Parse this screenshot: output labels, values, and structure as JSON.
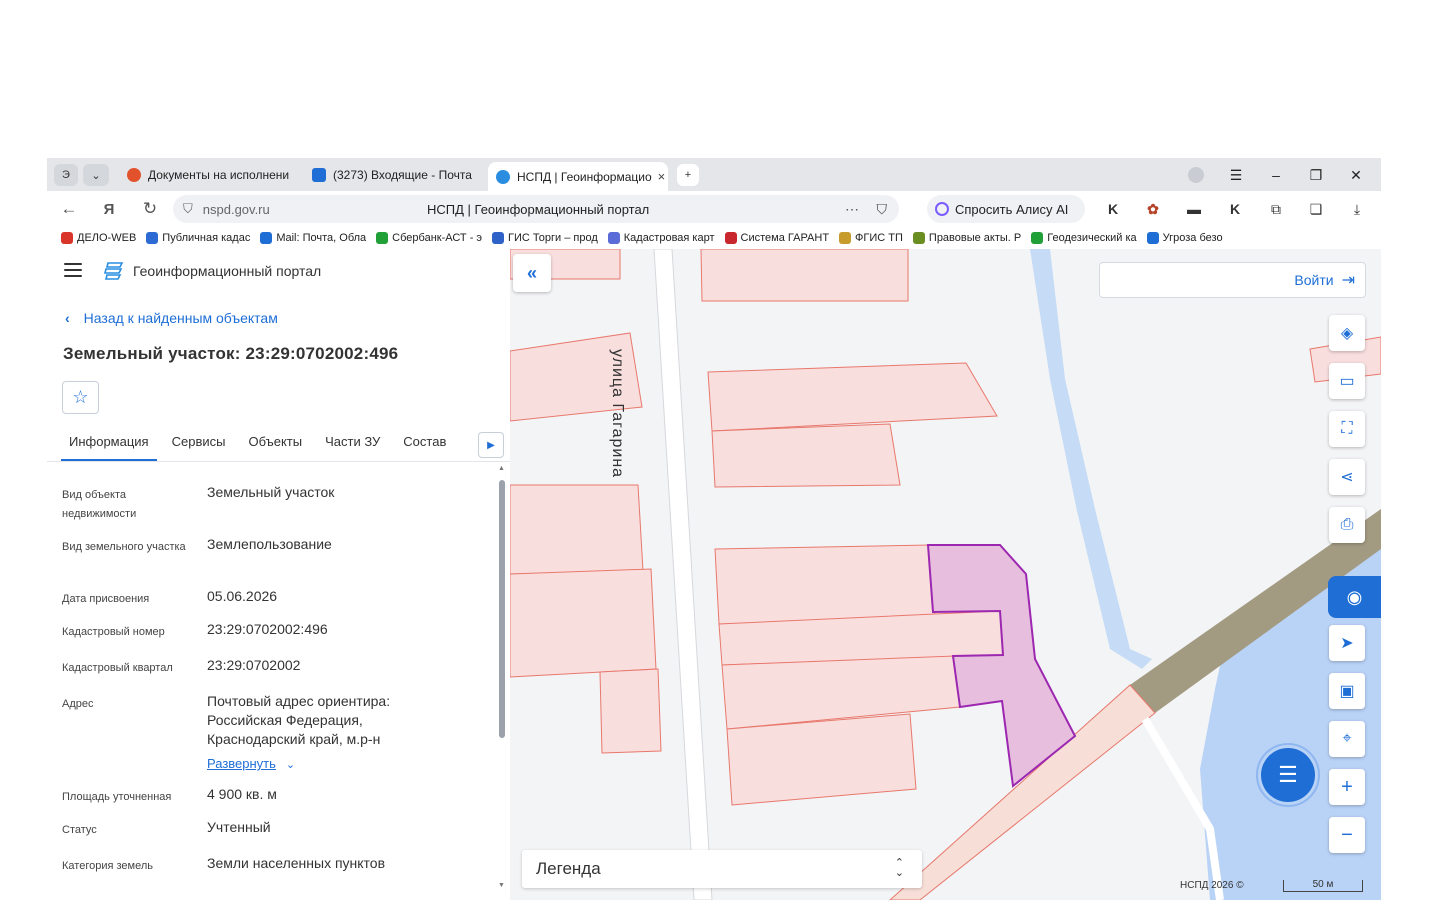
{
  "browser": {
    "tabs": [
      {
        "label": "Документы на исполнени",
        "active": false,
        "icon_color": "#e2532d"
      },
      {
        "label": "(3273) Входящие - Почта",
        "active": false,
        "icon_color": "#1e6ed6"
      },
      {
        "label": "НСПД | Геоинформацио",
        "active": true,
        "icon_color": "#2a8de0"
      }
    ],
    "tab_counter": "Э",
    "url_host": "nspd.gov.ru",
    "page_title": "НСПД | Геоинформационный портал",
    "alice_label": "Спросить Алису AI",
    "bookmarks": [
      {
        "label": "ДЕЛО-WEB",
        "color": "#d9352b"
      },
      {
        "label": "Публичная кадас",
        "color": "#2b6bd3"
      },
      {
        "label": "Mail: Почта, Обла",
        "color": "#1e6ed6"
      },
      {
        "label": "Сбербанк-АСТ - э",
        "color": "#21a038"
      },
      {
        "label": "ГИС Торги – прод",
        "color": "#2f62c8"
      },
      {
        "label": "Кадастровая карт",
        "color": "#5b6bd8"
      },
      {
        "label": "Система ГАРАНТ",
        "color": "#c8282d"
      },
      {
        "label": "ФГИС ТП",
        "color": "#c89b2d"
      },
      {
        "label": "Правовые акты. Р",
        "color": "#6b8e23"
      },
      {
        "label": "Геодезический ка",
        "color": "#21a038"
      },
      {
        "label": "Угроза безо",
        "color": "#1e6ed6"
      }
    ]
  },
  "panel": {
    "portal_name": "Геоинформационный портал",
    "back_link": "Назад к найденным объектам",
    "title": "Земельный участок: 23:29:0702002:496",
    "tabs": [
      "Информация",
      "Сервисы",
      "Объекты",
      "Части ЗУ",
      "Состав"
    ],
    "props": {
      "type_label": "Вид объекта недвижимости",
      "type_value": "Земельный участок",
      "land_label": "Вид земельного участка",
      "land_value": "Землепользование",
      "date_label": "Дата присвоения",
      "date_value": "05.06.2026",
      "cad_label": "Кадастровый номер",
      "cad_value": "23:29:0702002:496",
      "quarter_label": "Кадастровый квартал",
      "quarter_value": "23:29:0702002",
      "addr_label": "Адрес",
      "addr_value": "Почтовый адрес ориентира: Российская Федерация, Краснодарский край, м.р-н",
      "expand_label": "Развернуть",
      "area_label": "Площадь уточненная",
      "area_value": "4 900 кв. м",
      "status_label": "Статус",
      "status_value": "Учтенный",
      "category_label": "Категория земель",
      "category_value": "Земли населенных пунктов"
    }
  },
  "map": {
    "login_label": "Войти",
    "street_label": "улица  Гагарина",
    "legend_label": "Легенда",
    "copyright": "НСПД 2026 ©",
    "scale_label": "50 м",
    "colors": {
      "parcel_fill": "#f9dede",
      "parcel_stroke": "#e8786c",
      "selected_fill": "#e7bede",
      "selected_stroke": "#9c27b0",
      "water": "#b9d3f7",
      "road": "#a39a82",
      "accent": "#1e6ed6"
    },
    "tools": [
      "layers-icon",
      "ruler-icon",
      "select-area-icon",
      "share-icon",
      "print-icon",
      "assistant-icon",
      "locate-icon",
      "minimap-icon",
      "search-location-icon",
      "zoom-in-icon",
      "zoom-out-icon"
    ]
  }
}
